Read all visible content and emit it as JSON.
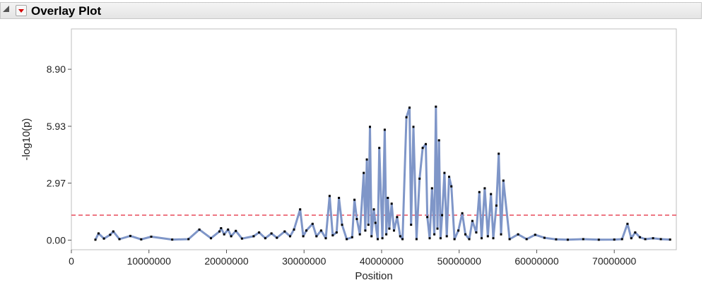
{
  "panel": {
    "title": "Overlay Plot"
  },
  "chart_data": {
    "type": "line",
    "xlabel": "Position",
    "ylabel": "-log10(p)",
    "xlim": [
      0,
      78000000
    ],
    "ylim": [
      -0.5,
      11.0
    ],
    "x_ticks": [
      0,
      10000000,
      20000000,
      30000000,
      40000000,
      50000000,
      60000000,
      70000000
    ],
    "x_tick_labels": [
      "0",
      "10000000",
      "20000000",
      "30000000",
      "40000000",
      "50000000",
      "60000000",
      "70000000"
    ],
    "y_ticks": [
      0,
      2.97,
      5.93,
      8.9
    ],
    "y_tick_labels": [
      "0.00",
      "2.97",
      "5.93",
      "8.90"
    ],
    "threshold": 1.3,
    "grid": false,
    "line_color": "#7f96c8",
    "marker_color": "#000000",
    "threshold_color": "#e84a5a",
    "x": [
      3100000,
      3500000,
      4200000,
      5000000,
      5400000,
      6200000,
      7600000,
      9000000,
      10300000,
      13000000,
      15100000,
      16500000,
      18000000,
      19100000,
      19300000,
      19700000,
      20200000,
      20600000,
      21200000,
      22000000,
      23500000,
      24200000,
      25000000,
      25800000,
      26500000,
      27500000,
      28200000,
      28700000,
      29500000,
      29900000,
      30300000,
      31100000,
      31600000,
      32200000,
      32800000,
      33300000,
      33700000,
      34200000,
      34500000,
      34900000,
      35500000,
      36200000,
      36500000,
      36800000,
      37200000,
      37700000,
      37900000,
      38100000,
      38300000,
      38500000,
      38700000,
      39000000,
      39200000,
      39500000,
      39700000,
      40100000,
      40400000,
      40600000,
      40800000,
      41000000,
      41300000,
      41600000,
      42000000,
      42400000,
      42700000,
      43200000,
      43600000,
      43800000,
      44100000,
      44500000,
      44900000,
      45300000,
      45700000,
      45900000,
      46200000,
      46500000,
      46800000,
      47000000,
      47200000,
      47400000,
      47600000,
      47800000,
      48100000,
      48400000,
      48700000,
      49000000,
      49400000,
      49900000,
      50400000,
      50800000,
      51300000,
      51700000,
      52200000,
      52600000,
      52900000,
      53300000,
      53700000,
      54100000,
      54400000,
      54800000,
      55100000,
      55400000,
      55700000,
      56500000,
      57600000,
      58700000,
      59800000,
      61000000,
      62500000,
      64000000,
      66000000,
      68000000,
      70000000,
      71000000,
      71700000,
      72200000,
      72700000,
      73300000,
      74000000,
      75000000,
      76000000,
      77200000
    ],
    "y": [
      0.02,
      0.35,
      0.08,
      0.28,
      0.45,
      0.05,
      0.22,
      0.04,
      0.18,
      0.03,
      0.05,
      0.55,
      0.1,
      0.45,
      0.62,
      0.3,
      0.55,
      0.2,
      0.48,
      0.08,
      0.2,
      0.4,
      0.1,
      0.35,
      0.12,
      0.45,
      0.2,
      0.55,
      1.6,
      0.2,
      0.5,
      0.85,
      0.2,
      0.5,
      0.1,
      2.3,
      0.25,
      0.4,
      2.2,
      0.8,
      0.05,
      0.15,
      2.1,
      1.1,
      0.3,
      3.5,
      0.5,
      4.2,
      0.8,
      5.9,
      0.2,
      1.6,
      0.9,
      0.05,
      4.8,
      0.1,
      5.75,
      0.3,
      2.2,
      0.6,
      1.9,
      0.5,
      1.2,
      0.2,
      0.05,
      6.4,
      6.9,
      0.8,
      5.9,
      0.05,
      3.2,
      4.8,
      5.0,
      1.2,
      0.1,
      2.7,
      0.3,
      6.95,
      0.6,
      5.2,
      0.1,
      1.3,
      3.5,
      0.2,
      3.3,
      2.8,
      0.05,
      0.5,
      1.4,
      0.3,
      0.05,
      1.0,
      0.4,
      2.5,
      0.1,
      2.7,
      0.2,
      2.4,
      0.1,
      1.8,
      4.5,
      0.3,
      3.1,
      0.05,
      0.3,
      0.05,
      0.28,
      0.12,
      0.04,
      0.02,
      0.05,
      0.02,
      0.03,
      0.05,
      0.85,
      0.1,
      0.4,
      0.15,
      0.05,
      0.1,
      0.05,
      0.03
    ]
  }
}
